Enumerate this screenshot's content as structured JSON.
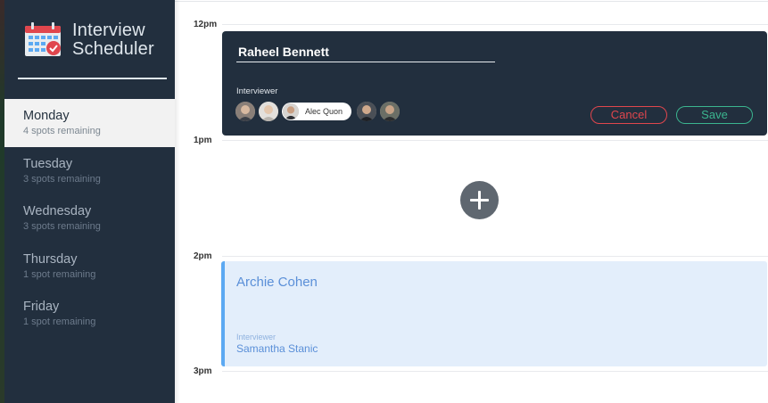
{
  "brand": {
    "title_line1": "Interview",
    "title_line2": "Scheduler",
    "icon": "calendar-check-icon"
  },
  "days": [
    {
      "name": "Monday",
      "spots": "4 spots remaining",
      "selected": true
    },
    {
      "name": "Tuesday",
      "spots": "3 spots remaining",
      "selected": false
    },
    {
      "name": "Wednesday",
      "spots": "3 spots remaining",
      "selected": false
    },
    {
      "name": "Thursday",
      "spots": "1 spot remaining",
      "selected": false
    },
    {
      "name": "Friday",
      "spots": "1 spot remaining",
      "selected": false
    }
  ],
  "hours": [
    "12pm",
    "1pm",
    "2pm",
    "3pm"
  ],
  "form": {
    "student_name": "Raheel Bennett",
    "interviewer_label": "Interviewer",
    "selected_interviewer": "Alec Quon",
    "cancel_label": "Cancel",
    "save_label": "Save"
  },
  "add_icon": "plus-icon",
  "appointment": {
    "student": "Archie Cohen",
    "interviewer_label": "Interviewer",
    "interviewer": "Samantha Stanic"
  },
  "colors": {
    "sidebar": "#222f3e",
    "selected_day_bg": "#f2f2f2",
    "cancel": "#e0464d",
    "save": "#3bb58f",
    "appointment_bg": "#e3eefb",
    "appointment_accent": "#5ca9f2"
  }
}
